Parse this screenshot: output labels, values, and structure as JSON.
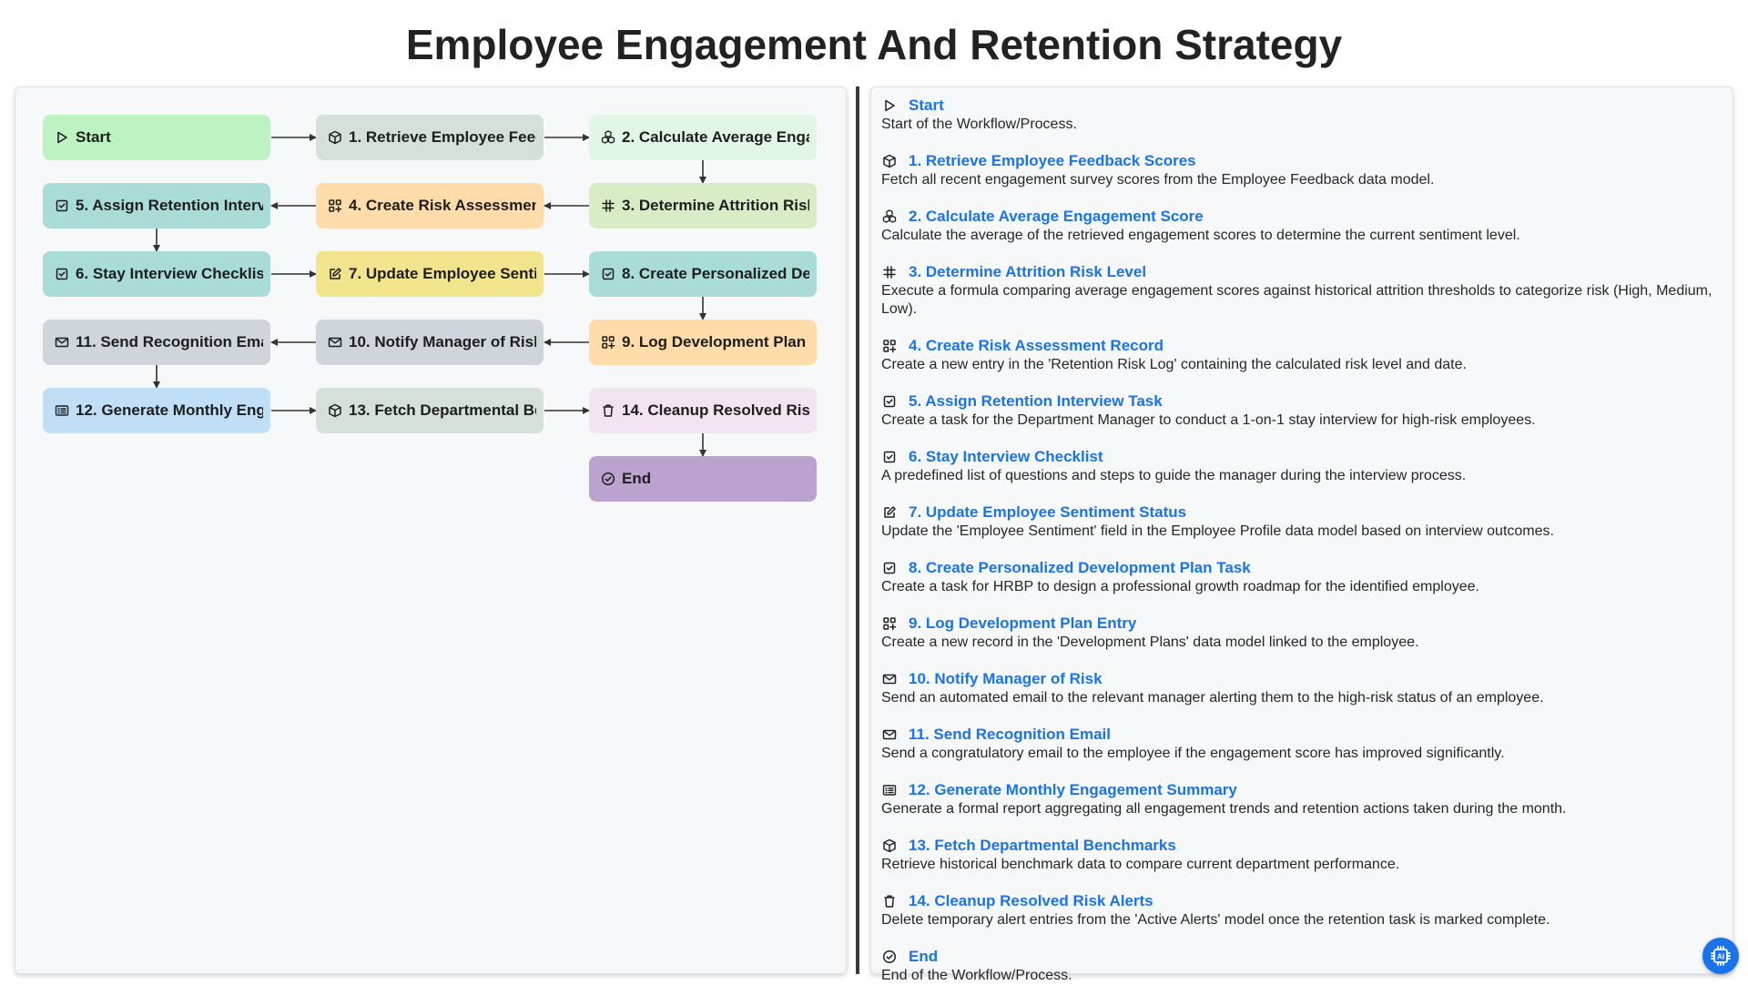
{
  "title": "Employee Engagement And Retention Strategy",
  "colors": {
    "link": "#1a73e8",
    "start": "#bdf2c3",
    "gray_green": "#d5e1d8",
    "mint": "#e2f6e8",
    "light_green": "#d8ecc6",
    "peach": "#ffdca9",
    "teal": "#a9dcd6",
    "yellow": "#f1e48c",
    "gray": "#cfd5db",
    "blue": "#c0dff6",
    "pink": "#f3e4f2",
    "purple": "#bca3cf"
  },
  "nodes": [
    {
      "id": "start",
      "label": "Start",
      "icon": "play-icon",
      "color": "#bdf2c3"
    },
    {
      "id": "n1",
      "label": "1. Retrieve Employee Feedback Scores",
      "icon": "cube-icon",
      "color": "#d5e1d8"
    },
    {
      "id": "n2",
      "label": "2. Calculate Average Engagement Score",
      "icon": "cubes-icon",
      "color": "#e2f6e8"
    },
    {
      "id": "n3",
      "label": "3. Determine Attrition Risk Level",
      "icon": "formula-icon",
      "color": "#d8ecc6"
    },
    {
      "id": "n4",
      "label": "4. Create Risk Assessment Record",
      "icon": "grid-plus-icon",
      "color": "#ffdca9"
    },
    {
      "id": "n5",
      "label": "5. Assign Retention Interview Task",
      "icon": "task-icon",
      "color": "#a9dcd6"
    },
    {
      "id": "n6",
      "label": "6. Stay Interview Checklist",
      "icon": "task-icon",
      "color": "#a9dcd6"
    },
    {
      "id": "n7",
      "label": "7. Update Employee Sentiment Status",
      "icon": "edit-icon",
      "color": "#f1e48c"
    },
    {
      "id": "n8",
      "label": "8. Create Personalized Development Plan Task",
      "icon": "task-icon",
      "color": "#a9dcd6"
    },
    {
      "id": "n9",
      "label": "9. Log Development Plan Entry",
      "icon": "grid-plus-icon",
      "color": "#ffdca9"
    },
    {
      "id": "n10",
      "label": "10. Notify Manager of Risk",
      "icon": "mail-icon",
      "color": "#cfd5db"
    },
    {
      "id": "n11",
      "label": "11. Send Recognition Email",
      "icon": "mail-icon",
      "color": "#cfd5db"
    },
    {
      "id": "n12",
      "label": "12. Generate Monthly Engagement Summary",
      "icon": "report-icon",
      "color": "#c0dff6"
    },
    {
      "id": "n13",
      "label": "13. Fetch Departmental Benchmarks",
      "icon": "cube-icon",
      "color": "#d5e1d8"
    },
    {
      "id": "n14",
      "label": "14. Cleanup Resolved Risk Alerts",
      "icon": "trash-icon",
      "color": "#f3e4f2"
    },
    {
      "id": "end",
      "label": "End",
      "icon": "check-circle-icon",
      "color": "#bca3cf"
    }
  ],
  "steps": [
    {
      "title": "Start",
      "icon": "play-icon",
      "desc": "Start of the Workflow/Process."
    },
    {
      "title": "1. Retrieve Employee Feedback Scores",
      "icon": "cube-icon",
      "desc": "Fetch all recent engagement survey scores from the Employee Feedback data model."
    },
    {
      "title": "2. Calculate Average Engagement Score",
      "icon": "cubes-icon",
      "desc": "Calculate the average of the retrieved engagement scores to determine the current sentiment level."
    },
    {
      "title": "3. Determine Attrition Risk Level",
      "icon": "formula-icon",
      "desc": "Execute a formula comparing average engagement scores against historical attrition thresholds to categorize risk (High, Medium, Low)."
    },
    {
      "title": "4. Create Risk Assessment Record",
      "icon": "grid-plus-icon",
      "desc": "Create a new entry in the 'Retention Risk Log' containing the calculated risk level and date."
    },
    {
      "title": "5. Assign Retention Interview Task",
      "icon": "task-icon",
      "desc": "Create a task for the Department Manager to conduct a 1-on-1 stay interview for high-risk employees."
    },
    {
      "title": "6. Stay Interview Checklist",
      "icon": "task-icon",
      "desc": "A predefined list of questions and steps to guide the manager during the interview process."
    },
    {
      "title": "7. Update Employee Sentiment Status",
      "icon": "edit-icon",
      "desc": "Update the 'Employee Sentiment' field in the Employee Profile data model based on interview outcomes."
    },
    {
      "title": "8. Create Personalized Development Plan Task",
      "icon": "task-icon",
      "desc": "Create a task for HRBP to design a professional growth roadmap for the identified employee."
    },
    {
      "title": "9. Log Development Plan Entry",
      "icon": "grid-plus-icon",
      "desc": "Create a new record in the 'Development Plans' data model linked to the employee."
    },
    {
      "title": "10. Notify Manager of Risk",
      "icon": "mail-icon",
      "desc": "Send an automated email to the relevant manager alerting them to the high-risk status of an employee."
    },
    {
      "title": "11. Send Recognition Email",
      "icon": "mail-icon",
      "desc": "Send a congratulatory email to the employee if the engagement score has improved significantly."
    },
    {
      "title": "12. Generate Monthly Engagement Summary",
      "icon": "report-icon",
      "desc": "Generate a formal report aggregating all engagement trends and retention actions taken during the month."
    },
    {
      "title": "13. Fetch Departmental Benchmarks",
      "icon": "cube-icon",
      "desc": "Retrieve historical benchmark data to compare current department performance."
    },
    {
      "title": "14. Cleanup Resolved Risk Alerts",
      "icon": "trash-icon",
      "desc": "Delete temporary alert entries from the 'Active Alerts' model once the retention task is marked complete."
    },
    {
      "title": "End",
      "icon": "check-circle-icon",
      "desc": "End of the Workflow/Process."
    }
  ],
  "ai_badge": {
    "icon": "ai-chip-icon"
  }
}
